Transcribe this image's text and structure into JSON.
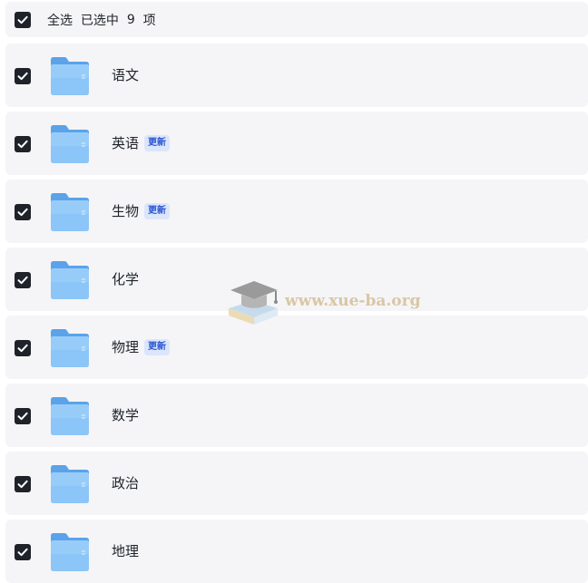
{
  "header": {
    "select_all_label": "全选",
    "selected_prefix": "已选中",
    "selected_count": "9",
    "selected_suffix": "项"
  },
  "items": [
    {
      "name": "语文",
      "badge": ""
    },
    {
      "name": "英语",
      "badge": "更新"
    },
    {
      "name": "生物",
      "badge": "更新"
    },
    {
      "name": "化学",
      "badge": ""
    },
    {
      "name": "物理",
      "badge": "更新"
    },
    {
      "name": "数学",
      "badge": ""
    },
    {
      "name": "政治",
      "badge": ""
    },
    {
      "name": "地理",
      "badge": ""
    }
  ],
  "watermark": {
    "text": "www.xue-ba.org"
  },
  "colors": {
    "row_background": "#f5f5f7",
    "checkbox": "#1f2329",
    "folder_blue": "#6aaef0",
    "badge_background": "#dbe5fb",
    "badge_text": "#2a56d1"
  }
}
